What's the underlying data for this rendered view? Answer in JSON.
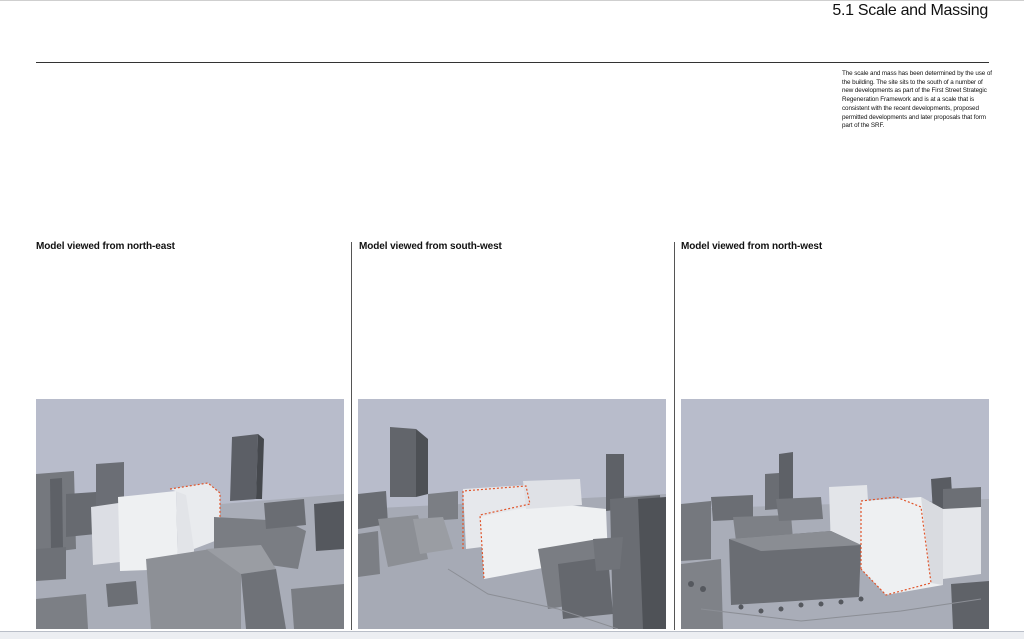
{
  "page": {
    "title": "5.1 Scale and Massing",
    "intro": "The scale and mass has been determined by the use of the building. The site sits to the south of a number of new developments as part of the First Street Strategic Regeneration Framework and is at a scale that is consistent with the recent developments, proposed permitted developments and later proposals that form part of the SRF."
  },
  "views": [
    {
      "caption": "Model viewed from north-east"
    },
    {
      "caption": "Model viewed from south-west"
    },
    {
      "caption": "Model viewed from north-west"
    }
  ],
  "colors": {
    "sky": "#b9bccb",
    "model_grey": "#8a8d93",
    "proposal_white": "#eef0f2",
    "site_outline": "#e0542a"
  }
}
